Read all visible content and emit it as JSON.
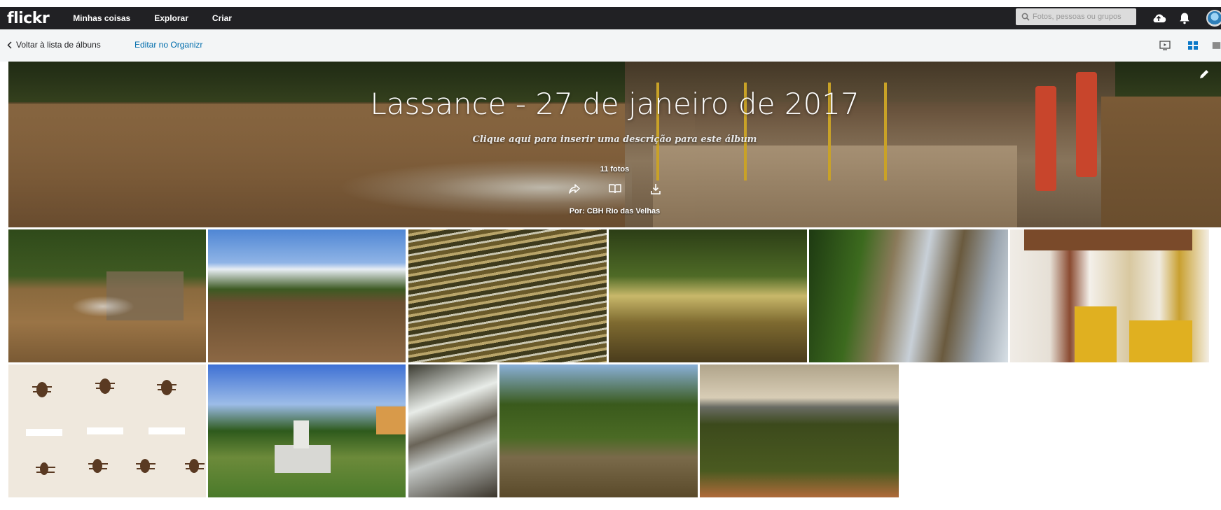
{
  "nav": {
    "logo": "flickr",
    "links": [
      "Minhas coisas",
      "Explorar",
      "Criar"
    ],
    "search_placeholder": "Fotos, pessoas ou grupos"
  },
  "subbar": {
    "back_label": "Voltar à lista de álbuns",
    "organizr_label": "Editar no Organizr"
  },
  "album": {
    "title": "Lassance - 27 de janeiro de 2017",
    "description_prompt": "Clique aqui para inserir uma descrição para este álbum",
    "photo_count": "11 fotos",
    "byline_prefix": "Por: ",
    "owner": "CBH Rio das Velhas"
  },
  "photos": [
    {
      "subject": "ferry crossing river"
    },
    {
      "subject": "river with blue sky"
    },
    {
      "subject": "water reflections"
    },
    {
      "subject": "stream in forest"
    },
    {
      "subject": "small waterfall"
    },
    {
      "subject": "museum gallery"
    },
    {
      "subject": "insect specimens"
    },
    {
      "subject": "statue in garden"
    },
    {
      "subject": "rapids and rocks"
    },
    {
      "subject": "calm river pool"
    },
    {
      "subject": "cerrado landscape"
    }
  ],
  "icons": {
    "upload": "cloud-upload-icon",
    "notifications": "bell-icon",
    "share": "share-icon",
    "book": "book-icon",
    "download": "download-icon",
    "edit": "pencil-icon",
    "slideshow": "slideshow-icon",
    "grid": "grid-icon"
  },
  "colors": {
    "nav_bg": "#212124",
    "link_blue": "#006dac",
    "subbar_bg": "#f3f5f6"
  }
}
